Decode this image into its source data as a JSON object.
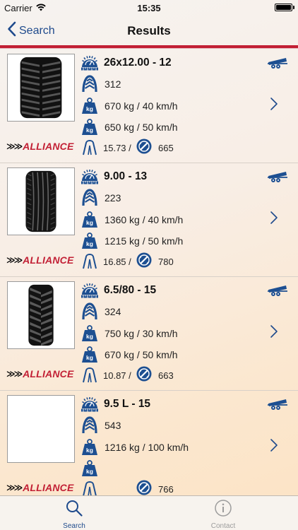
{
  "status_bar": {
    "carrier": "Carrier",
    "time": "15:35"
  },
  "nav": {
    "back_label": "Search",
    "title": "Results"
  },
  "colors": {
    "brand_red": "#c21f34",
    "brand_blue": "#1e4a8c",
    "icon_blue": "#1d4f91"
  },
  "results": [
    {
      "size": "26x12.00 - 12",
      "spec_number": "312",
      "load_1": "670 kg / 40 km/h",
      "load_2": "650 kg / 50 km/h",
      "ratio": "15.73 /",
      "code": "665",
      "brand": "ALLIANCE",
      "has_image": true
    },
    {
      "size": "9.00 - 13",
      "spec_number": "223",
      "load_1": "1360 kg / 40 km/h",
      "load_2": "1215 kg / 50 km/h",
      "ratio": "16.85 /",
      "code": "780",
      "brand": "ALLIANCE",
      "has_image": true
    },
    {
      "size": "6.5/80 - 15",
      "spec_number": "324",
      "load_1": "750 kg / 30 km/h",
      "load_2": "670 kg / 50 km/h",
      "ratio": "10.87 /",
      "code": "663",
      "brand": "ALLIANCE",
      "has_image": true
    },
    {
      "size": "9.5 L - 15",
      "spec_number": "543",
      "load_1": "1216 kg / 100 km/h",
      "load_2": "",
      "ratio": "",
      "code": "766",
      "brand": "ALLIANCE",
      "has_image": false
    }
  ],
  "tab_bar": {
    "tabs": [
      {
        "label": "Search",
        "icon": "search-icon",
        "active": true
      },
      {
        "label": "Contact",
        "icon": "info-icon",
        "active": false
      }
    ]
  }
}
